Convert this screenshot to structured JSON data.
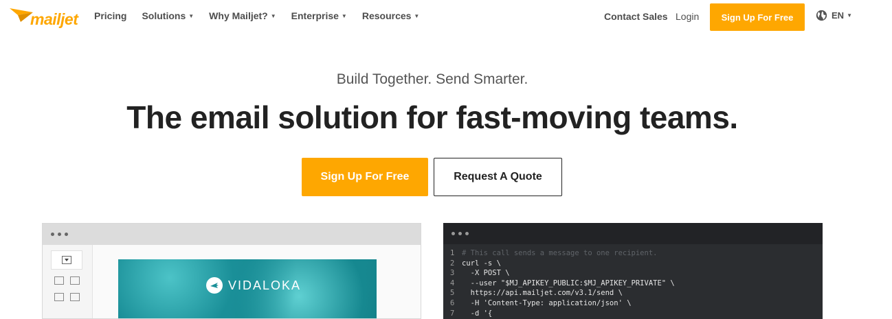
{
  "nav": {
    "logo": "mailjet",
    "links": [
      {
        "label": "Pricing",
        "caret": false
      },
      {
        "label": "Solutions",
        "caret": true
      },
      {
        "label": "Why Mailjet?",
        "caret": true
      },
      {
        "label": "Enterprise",
        "caret": true
      },
      {
        "label": "Resources",
        "caret": true
      }
    ],
    "contact_sales": "Contact Sales",
    "login": "Login",
    "signup": "Sign Up For Free",
    "language": "EN"
  },
  "hero": {
    "tagline": "Build Together. Send Smarter.",
    "headline": "The email solution for fast-moving teams.",
    "cta_primary": "Sign Up For Free",
    "cta_secondary": "Request A Quote"
  },
  "editor": {
    "brand": "VIDALOKA"
  },
  "code": {
    "lines": [
      {
        "n": "1",
        "text": "# This call sends a message to one recipient.",
        "type": "comment"
      },
      {
        "n": "2",
        "text": "curl -s \\",
        "type": "code"
      },
      {
        "n": "3",
        "text": "  -X POST \\",
        "type": "code"
      },
      {
        "n": "4",
        "text": "  --user \"$MJ_APIKEY_PUBLIC:$MJ_APIKEY_PRIVATE\" \\",
        "type": "code"
      },
      {
        "n": "5",
        "text": "  https://api.mailjet.com/v3.1/send \\",
        "type": "code"
      },
      {
        "n": "6",
        "text": "  -H 'Content-Type: application/json' \\",
        "type": "code"
      },
      {
        "n": "7",
        "text": "  -d '{",
        "type": "code"
      }
    ]
  },
  "colors": {
    "brand": "#fea701",
    "code_bg": "#2b2d30"
  }
}
